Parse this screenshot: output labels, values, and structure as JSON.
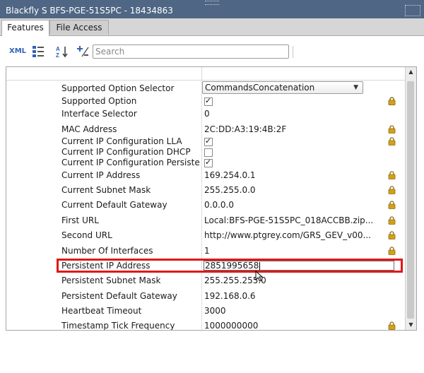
{
  "window": {
    "title": "Blackfly S BFS-PGE-51S5PC - 18434863"
  },
  "tabs": [
    {
      "label": "Features",
      "active": true
    },
    {
      "label": "File Access",
      "active": false
    }
  ],
  "toolbar": {
    "xml_label": "XML",
    "search_placeholder": "Search",
    "icons": [
      "xml-icon",
      "expand-tree-icon",
      "sort-az-icon",
      "add-remove-icon"
    ]
  },
  "properties": [
    {
      "name": "Supported Option Selector",
      "value": "CommandsConcatenation",
      "type": "dropdown",
      "locked": true
    },
    {
      "name": "Supported Option",
      "checked": true,
      "type": "checkbox",
      "locked": true
    },
    {
      "name": "Interface Selector",
      "value": "0",
      "type": "text",
      "locked": false
    },
    {
      "name": "MAC Address",
      "value": "2C:DD:A3:19:4B:2F",
      "type": "text",
      "locked": true
    },
    {
      "name": "Current IP Configuration LLA",
      "checked": true,
      "type": "checkbox",
      "locked": true
    },
    {
      "name": "Current IP Configuration DHCP",
      "checked": false,
      "type": "checkbox",
      "locked": false
    },
    {
      "name": "Current IP Configuration Persiste...",
      "checked": true,
      "type": "checkbox",
      "locked": false
    },
    {
      "name": "Current IP Address",
      "value": "169.254.0.1",
      "type": "text",
      "locked": true
    },
    {
      "name": "Current Subnet Mask",
      "value": "255.255.0.0",
      "type": "text",
      "locked": true
    },
    {
      "name": "Current Default Gateway",
      "value": "0.0.0.0",
      "type": "text",
      "locked": true
    },
    {
      "name": "First URL",
      "value": "Local:BFS-PGE-51S5PC_018ACCBB.zip...",
      "type": "text",
      "locked": true
    },
    {
      "name": "Second URL",
      "value": "http://www.ptgrey.com/GRS_GEV_v00...",
      "type": "text",
      "locked": true
    },
    {
      "name": "Number Of Interfaces",
      "value": "1",
      "type": "text",
      "locked": true
    },
    {
      "name": "Persistent IP Address",
      "value": "2851995658",
      "type": "editing",
      "locked": false
    },
    {
      "name": "Persistent Subnet Mask",
      "value": "255.255.255.0",
      "type": "text",
      "locked": false
    },
    {
      "name": "Persistent Default Gateway",
      "value": "192.168.0.6",
      "type": "text",
      "locked": false
    },
    {
      "name": "Heartbeat Timeout",
      "value": "3000",
      "type": "text",
      "locked": false
    },
    {
      "name": "Timestamp Tick Frequency",
      "value": "1000000000",
      "type": "text",
      "locked": true
    }
  ],
  "colors": {
    "titlebar": "#4f6684",
    "highlight": "#e01818",
    "lock": "#d4a017",
    "xml": "#2f62b8"
  }
}
